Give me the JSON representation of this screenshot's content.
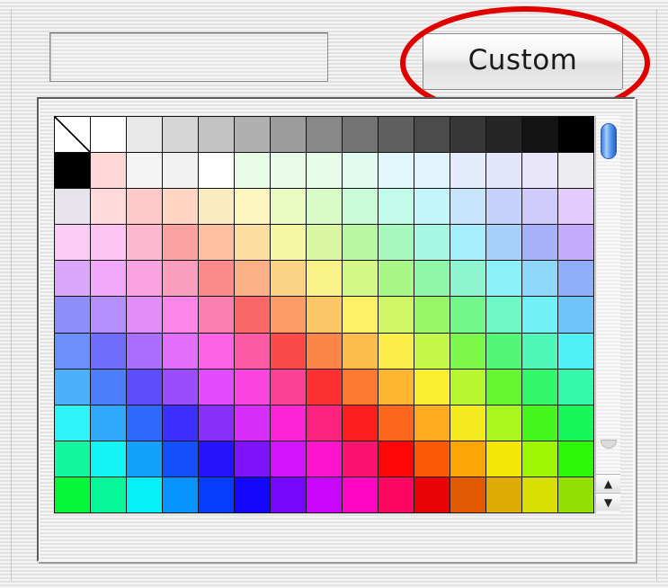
{
  "dialog": {
    "custom_button_label": "Custom",
    "selected_color_hex": "",
    "highlight_color": "#e00000"
  },
  "palette": {
    "columns": 15,
    "rows": [
      [
        "none",
        "#ffffff",
        "#e8e8e8",
        "#d6d6d6",
        "#c3c3c3",
        "#b0b0b0",
        "#9c9c9c",
        "#888888",
        "#737373",
        "#5f5f5f",
        "#4b4b4b",
        "#373737",
        "#262626",
        "#141414",
        "#000000"
      ],
      [
        "#000000",
        "#ffd7d7",
        "#f4f4f4",
        "#f1f1f1",
        "#ffffff",
        "#e7fbe7",
        "#e8fae9",
        "#e6fbe8",
        "#e2fbf0",
        "#e2f7fb",
        "#e2f4fb",
        "#e4ebfb",
        "#e3e6fb",
        "#e9e6fb",
        "#ececf0"
      ],
      [
        "#e7e3ea",
        "#ffd9dc",
        "#ffc9c9",
        "#ffd6c4",
        "#fbebc0",
        "#fbf5c0",
        "#eafbc0",
        "#d7fbc6",
        "#c9fbd8",
        "#c3fbea",
        "#c3f6fb",
        "#c7e4fb",
        "#c6d2fb",
        "#d1cbfb",
        "#e3cbfb"
      ],
      [
        "#fccbf5",
        "#fcc5f3",
        "#fcb8cf",
        "#fca2a2",
        "#fcc0a0",
        "#fcdfa0",
        "#f6f7a2",
        "#d9f7a2",
        "#b9f7a2",
        "#a7f7bf",
        "#a6f7e4",
        "#a6eefb",
        "#a7cffb",
        "#a8b2fb",
        "#c2acfb"
      ],
      [
        "#d8a7fb",
        "#f2a8fb",
        "#fca3e3",
        "#fc9fbf",
        "#fc8a8a",
        "#fcb087",
        "#fcd287",
        "#f9f387",
        "#d4f887",
        "#a9f787",
        "#8ff7a7",
        "#8ef7d1",
        "#8df2f7",
        "#8ed8fb",
        "#8eadfb"
      ],
      [
        "#8e8efb",
        "#b48efb",
        "#e18efb",
        "#fc86ea",
        "#fc7fb1",
        "#fc6767",
        "#fc9c67",
        "#fcc867",
        "#fcf167",
        "#cff767",
        "#98f767",
        "#72f78d",
        "#71f7c6",
        "#71f0f7",
        "#71c4fb"
      ],
      [
        "#6c8ffc",
        "#6f6efc",
        "#a96ffc",
        "#e16ffc",
        "#fc62e6",
        "#fc5aa5",
        "#fc4a4a",
        "#fc864a",
        "#fcbd4a",
        "#fcee4a",
        "#c3f74a",
        "#7df74a",
        "#52f779",
        "#4ff7b8",
        "#4ff1f7"
      ],
      [
        "#4cb1fc",
        "#4c7efc",
        "#5c4cfc",
        "#9b4cfc",
        "#e24cfc",
        "#fc44df",
        "#fc3f97",
        "#fc3030",
        "#fc7a30",
        "#fcb630",
        "#f9ee30",
        "#b8f730",
        "#64f730",
        "#33f76a",
        "#33f7ab"
      ],
      [
        "#2cf4f7",
        "#2ea9fc",
        "#2e68fc",
        "#3c2efc",
        "#8a2efc",
        "#d72efc",
        "#fc24d4",
        "#fc227f",
        "#fc1d1d",
        "#fc661d",
        "#fcac1d",
        "#f5ea1d",
        "#aaf71d",
        "#46f71d",
        "#16f75a"
      ],
      [
        "#14f7a0",
        "#13f4f7",
        "#13a0fc",
        "#1350fc",
        "#2513fc",
        "#7f13fc",
        "#d313fc",
        "#fc13cd",
        "#fc1370",
        "#fc0606",
        "#fc5906",
        "#fca506",
        "#f4e706",
        "#9ff706",
        "#2bf706"
      ],
      [
        "#06f73a",
        "#06f79a",
        "#06f0f7",
        "#0694fc",
        "#063cfc",
        "#1506fc",
        "#7606fc",
        "#cb06fc",
        "#fc06c2",
        "#fc0662",
        "#e80404",
        "#e25a04",
        "#e0aa04",
        "#d9de04",
        "#93e004"
      ]
    ]
  }
}
